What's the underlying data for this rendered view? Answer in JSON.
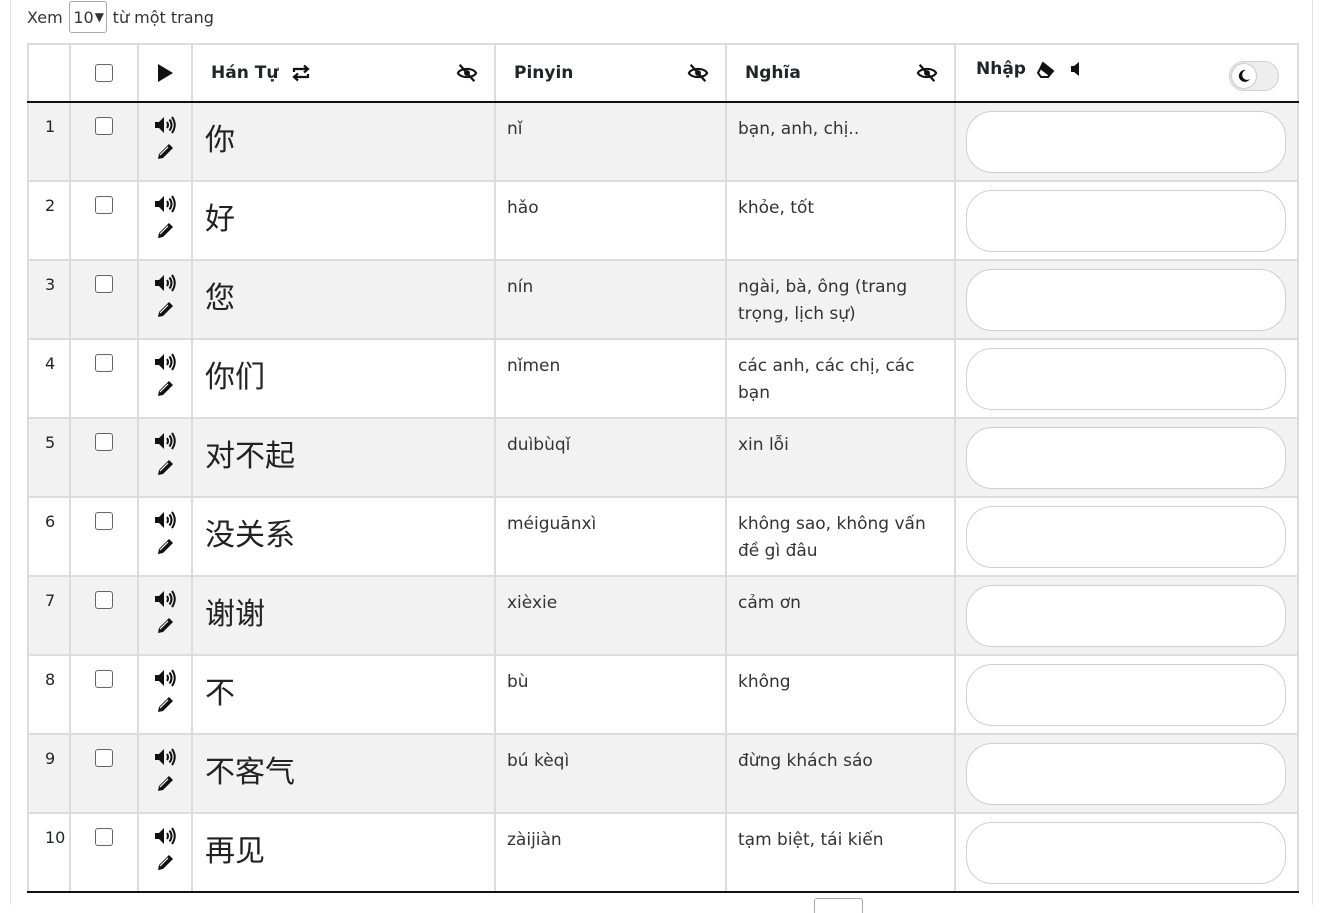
{
  "length_control": {
    "prefix": "Xem",
    "selected": "10",
    "suffix": "từ một trang"
  },
  "columns": {
    "han_tu": "Hán Tự",
    "pinyin": "Pinyin",
    "nghia": "Nghĩa",
    "nhap": "Nhập"
  },
  "rows": [
    {
      "n": "1",
      "hanzi": "你",
      "pinyin": "nǐ",
      "meaning": "bạn, anh, chị.."
    },
    {
      "n": "2",
      "hanzi": "好",
      "pinyin": "hǎo",
      "meaning": "khỏe, tốt"
    },
    {
      "n": "3",
      "hanzi": "您",
      "pinyin": "nín",
      "meaning": "ngài, bà, ông (trang trọng, lịch sự)"
    },
    {
      "n": "4",
      "hanzi": "你们",
      "pinyin": "nǐmen",
      "meaning": "các anh, các chị, các bạn"
    },
    {
      "n": "5",
      "hanzi": "对不起",
      "pinyin": "duìbùqǐ",
      "meaning": "xin lỗi"
    },
    {
      "n": "6",
      "hanzi": "没关系",
      "pinyin": "méiguānxì",
      "meaning": "không sao, không vấn đề gì đâu"
    },
    {
      "n": "7",
      "hanzi": "谢谢",
      "pinyin": "xièxie",
      "meaning": "cảm ơn"
    },
    {
      "n": "8",
      "hanzi": "不",
      "pinyin": "bù",
      "meaning": "không"
    },
    {
      "n": "9",
      "hanzi": "不客气",
      "pinyin": "bú kèqì",
      "meaning": "đừng khách sáo"
    },
    {
      "n": "10",
      "hanzi": "再见",
      "pinyin": "zàijiàn",
      "meaning": "tạm biệt, tái kiến"
    }
  ],
  "icons": {
    "play_all": "play-icon",
    "swap": "swap-icon",
    "hide": "eye-slash-icon",
    "speaker": "speaker-icon",
    "edit": "pencil-icon",
    "eraser": "eraser-icon",
    "volume": "volume-off-icon",
    "theme_toggle": "moon-icon"
  }
}
